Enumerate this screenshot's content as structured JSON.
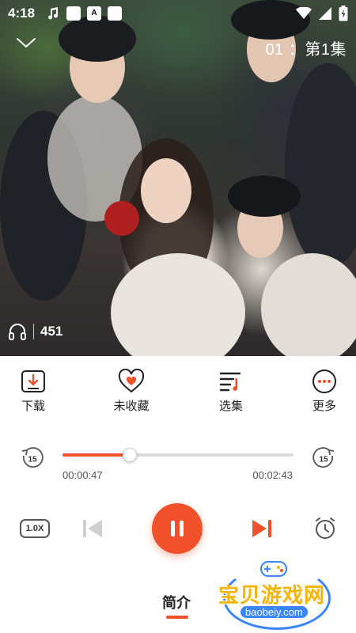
{
  "status_bar": {
    "time": "4:18",
    "left_icons": [
      "music-note-icon",
      "app-icon",
      "a-icon",
      "app-icon"
    ],
    "right_icons": [
      "wifi-icon",
      "signal-icon",
      "battery-icon"
    ]
  },
  "header": {
    "collapse_icon": "chevron-down-icon",
    "episode": "01 ：第1集"
  },
  "cover": {
    "listen_count": "451",
    "listen_icon": "headphones-icon"
  },
  "actions": [
    {
      "label": "下载",
      "icon": "download-icon"
    },
    {
      "label": "未收藏",
      "icon": "heart-icon"
    },
    {
      "label": "选集",
      "icon": "playlist-icon"
    },
    {
      "label": "更多",
      "icon": "more-icon"
    }
  ],
  "progress": {
    "current_time": "00:00:47",
    "total_time": "00:02:43",
    "fraction": 0.29,
    "skip_back": "15",
    "skip_forward": "15"
  },
  "controls": {
    "speed": "1.0X"
  },
  "bottom_tab": {
    "label": "简介"
  },
  "watermark": {
    "title": "宝贝游戏网",
    "url": "baobeiy.com"
  },
  "colors": {
    "accent": "#f0502a",
    "text": "#222222"
  }
}
